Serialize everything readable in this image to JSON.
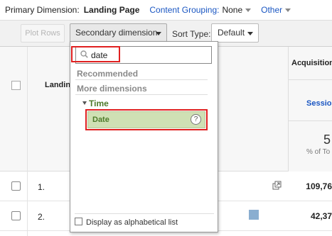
{
  "topbar": {
    "primary_label": "Primary Dimension:",
    "landing_page": "Landing Page",
    "content_grouping": "Content Grouping:",
    "content_grouping_value": "None",
    "other": "Other"
  },
  "toolbar": {
    "plot_rows": "Plot Rows",
    "secondary_dimension": "Secondary dimension",
    "sort_type_label": "Sort Type:",
    "sort_type_value": "Default"
  },
  "table": {
    "landing_header": "Landin",
    "acquisition_header": "Acquisition",
    "sessions_header": "Sessio",
    "total_value": "5",
    "total_pct": "% of To",
    "rows": [
      {
        "num": "1.",
        "value": "109,76"
      },
      {
        "num": "2.",
        "value": "42,37"
      }
    ]
  },
  "dropdown": {
    "search_value": "date",
    "recommended": "Recommended",
    "more_dimensions": "More dimensions",
    "time_group": "Time",
    "date_item": "Date",
    "help": "?",
    "alphabetical": "Display as alphabetical list"
  },
  "colors": {
    "accent": "#1a56c2",
    "highlight": "#e02020",
    "selected_bg": "#cfe0b4",
    "group_text": "#4d7a2a"
  }
}
